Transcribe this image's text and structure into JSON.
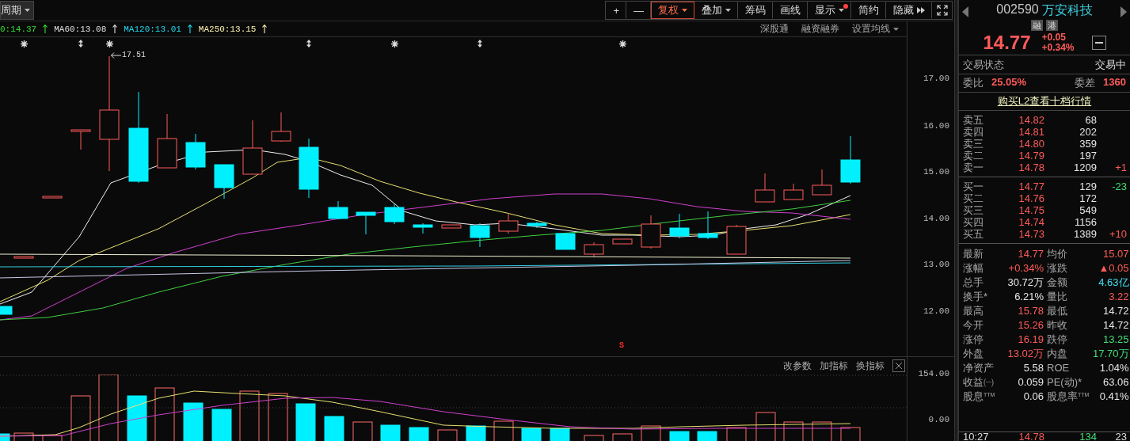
{
  "toolbar": {
    "period_button": {
      "label": "周期",
      "dropdown": true
    },
    "buttons": [
      {
        "kind": "text",
        "label": "+",
        "selected": false,
        "dropdown": false,
        "dot": false,
        "expand": false
      },
      {
        "kind": "text",
        "label": "—",
        "selected": false,
        "dropdown": false,
        "dot": false,
        "expand": false
      },
      {
        "kind": "text",
        "label": "复权",
        "selected": true,
        "dropdown": true,
        "dot": false,
        "expand": false
      },
      {
        "kind": "text",
        "label": "叠加",
        "selected": false,
        "dropdown": true,
        "dot": false,
        "expand": false
      },
      {
        "kind": "text",
        "label": "筹码",
        "selected": false,
        "dropdown": false,
        "dot": false,
        "expand": false
      },
      {
        "kind": "text",
        "label": "画线",
        "selected": false,
        "dropdown": false,
        "dot": false,
        "expand": false
      },
      {
        "kind": "text",
        "label": "显示",
        "selected": false,
        "dropdown": true,
        "dot": true,
        "expand": false
      },
      {
        "kind": "text",
        "label": "简约",
        "selected": false,
        "dropdown": false,
        "dot": false,
        "expand": false
      },
      {
        "kind": "text",
        "label": "隐藏",
        "selected": false,
        "dropdown": false,
        "dot": false,
        "expand": true
      },
      {
        "kind": "fullscreen",
        "selected": false
      }
    ]
  },
  "legend": [
    {
      "text": "0:14.37",
      "color": "#33dd33"
    },
    {
      "text": "MA60:13.08",
      "color": "#e0e0e0"
    },
    {
      "text": "MA120:13.01",
      "color": "#22d8f0"
    },
    {
      "text": "MA250:13.15",
      "color": "#fff4b0"
    }
  ],
  "chart_links": [
    {
      "label": "深股通",
      "dropdown": false
    },
    {
      "label": "融资融券",
      "dropdown": false
    },
    {
      "label": "设置均线",
      "dropdown": true
    }
  ],
  "price_chart": {
    "high_label": "17.51",
    "signal_label": "S",
    "axis_labels": [
      "17.00",
      "16.00",
      "15.00",
      "14.00",
      "13.00",
      "12.00"
    ]
  },
  "volume_chart": {
    "actions": [
      "改参数",
      "加指标",
      "换指标"
    ],
    "axis_labels": [
      "154.00",
      "0.00"
    ]
  },
  "quote": {
    "code": "002590",
    "name": "万安科技",
    "badges": [
      "融",
      "港"
    ],
    "price": "14.77",
    "change": "+0.05",
    "change_pct": "+0.34%",
    "status_label": "交易状态",
    "status": "交易中",
    "ratio": [
      {
        "label": "委比",
        "value": "25.05%"
      },
      {
        "label": "委差",
        "value": "1360"
      }
    ],
    "l2_link": "购买L2查看十档行情",
    "asks": [
      {
        "label": "卖五",
        "price": "14.82",
        "volume": "68"
      },
      {
        "label": "卖四",
        "price": "14.81",
        "volume": "202"
      },
      {
        "label": "卖三",
        "price": "14.80",
        "volume": "359"
      },
      {
        "label": "卖二",
        "price": "14.79",
        "volume": "197"
      },
      {
        "label": "卖一",
        "price": "14.78",
        "volume": "1209",
        "change": {
          "text": "+1",
          "color": "#ff5a5a"
        }
      }
    ],
    "bids": [
      {
        "label": "买一",
        "price": "14.77",
        "volume": "129",
        "change": {
          "text": "-23",
          "color": "#44dd77"
        }
      },
      {
        "label": "买二",
        "price": "14.76",
        "volume": "172"
      },
      {
        "label": "买三",
        "price": "14.75",
        "volume": "549"
      },
      {
        "label": "买四",
        "price": "14.74",
        "volume": "1156"
      },
      {
        "label": "买五",
        "price": "14.73",
        "volume": "1389",
        "change": {
          "text": "+10",
          "color": "#ff5a5a"
        }
      }
    ],
    "stats": [
      {
        "label": "最新",
        "value": "14.77",
        "color": "#ff5a5a"
      },
      {
        "label": "均价",
        "value": "15.07",
        "color": "#ff5a5a"
      },
      {
        "label": "涨幅",
        "value": "+0.34%",
        "color": "#ff5a5a"
      },
      {
        "label": "涨跌",
        "value": "▲0.05",
        "color": "#ff5a5a"
      },
      {
        "label": "总手",
        "value": "30.72万",
        "color": "#e6e6e6"
      },
      {
        "label": "金额",
        "value": "4.63亿",
        "color": "#3fe0f0"
      },
      {
        "label": "换手*",
        "value": "6.21%",
        "color": "#e6e6e6"
      },
      {
        "label": "量比",
        "value": "3.22",
        "color": "#ff5a5a"
      },
      {
        "label": "最高",
        "value": "15.78",
        "color": "#ff5a5a"
      },
      {
        "label": "最低",
        "value": "14.72",
        "color": "#e6e6e6"
      },
      {
        "label": "今开",
        "value": "15.26",
        "color": "#ff5a5a"
      },
      {
        "label": "昨收",
        "value": "14.72",
        "color": "#e6e6e6"
      },
      {
        "label": "涨停",
        "value": "16.19",
        "color": "#ff5a5a"
      },
      {
        "label": "跌停",
        "value": "13.25",
        "color": "#44dd77"
      },
      {
        "label": "外盘",
        "value": "13.02万",
        "color": "#ff5a5a"
      },
      {
        "label": "内盘",
        "value": "17.70万",
        "color": "#44dd77"
      },
      {
        "label": "净资产",
        "value": "5.58",
        "color": "#e6e6e6"
      },
      {
        "label": "ROE",
        "value": "1.04%",
        "color": "#e6e6e6"
      },
      {
        "label": "收益㈠",
        "value": "0.059",
        "color": "#e6e6e6"
      },
      {
        "label": "PE(动)*",
        "value": "63.06",
        "color": "#e6e6e6"
      },
      {
        "label": "股息$^{TTM}$",
        "value": "0.06",
        "color": "#e6e6e6"
      },
      {
        "label": "股息率$^{TTM}$",
        "value": "0.41%",
        "color": "#e6e6e6"
      }
    ],
    "ticks": [
      {
        "time": "10:27",
        "price": "14.78",
        "volume": "134",
        "count": "23"
      }
    ]
  }
}
